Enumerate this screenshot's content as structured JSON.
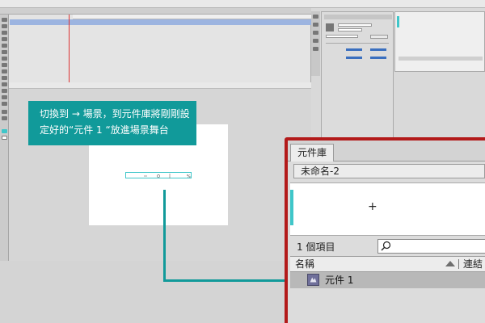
{
  "callout": {
    "line1": "切換到 → 場景，到元件庫將剛剛設",
    "line2": "定好的“元件 1 “放進場景舞台"
  },
  "library": {
    "tab_label": "元件庫",
    "document_name": "未命名-2",
    "item_count": "1 個項目",
    "search_placeholder": "",
    "columns": {
      "name": "名稱",
      "linkage": "連結"
    },
    "items": [
      {
        "label": "元件 1"
      }
    ]
  },
  "colors": {
    "callout": "#119a9a",
    "frame": "#b31a1a",
    "accent": "#3fc6c9"
  }
}
